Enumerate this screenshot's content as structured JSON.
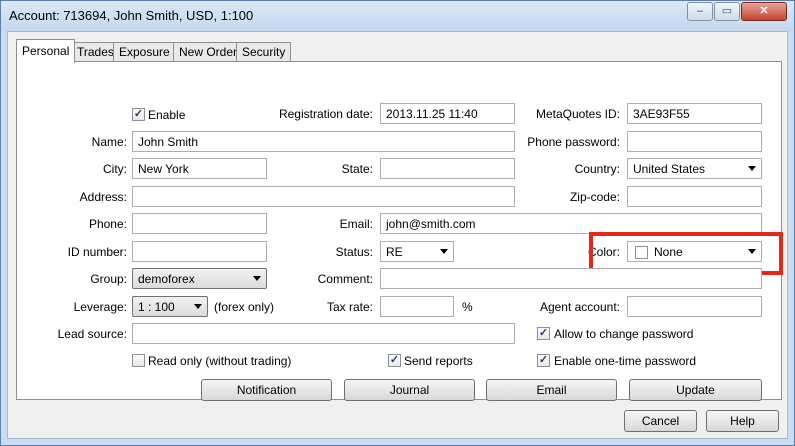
{
  "window": {
    "title": "Account: 713694, John Smith, USD, 1:100",
    "minimize_glyph": "–",
    "maximize_glyph": "▭",
    "close_glyph": "✕"
  },
  "tabs": [
    {
      "label": "Personal",
      "active": true
    },
    {
      "label": "Trades",
      "active": false
    },
    {
      "label": "Exposure",
      "active": false
    },
    {
      "label": "New Order",
      "active": false
    },
    {
      "label": "Security",
      "active": false
    }
  ],
  "form": {
    "enable": {
      "label": "Enable",
      "checked": true,
      "mark": "✓"
    },
    "registration_date": {
      "label": "Registration date:",
      "value": "2013.11.25 11:40"
    },
    "metaquotes_id": {
      "label": "MetaQuotes ID:",
      "value": "3AE93F55"
    },
    "name": {
      "label": "Name:",
      "value": "John Smith"
    },
    "phone_password": {
      "label": "Phone password:",
      "value": ""
    },
    "city": {
      "label": "City:",
      "value": "New York"
    },
    "state": {
      "label": "State:",
      "value": ""
    },
    "country": {
      "label": "Country:",
      "value": "United States"
    },
    "address": {
      "label": "Address:",
      "value": ""
    },
    "zip_code": {
      "label": "Zip-code:",
      "value": ""
    },
    "phone": {
      "label": "Phone:",
      "value": ""
    },
    "email": {
      "label": "Email:",
      "value": "john@smith.com"
    },
    "id_number": {
      "label": "ID number:",
      "value": ""
    },
    "status": {
      "label": "Status:",
      "value": "RE"
    },
    "color": {
      "label": "Color:",
      "value": "None"
    },
    "group": {
      "label": "Group:",
      "value": "demoforex"
    },
    "comment": {
      "label": "Comment:",
      "value": ""
    },
    "leverage": {
      "label": "Leverage:",
      "value": "1 : 100",
      "note": "(forex only)"
    },
    "tax_rate": {
      "label": "Tax rate:",
      "value": "",
      "unit": "%"
    },
    "agent_account": {
      "label": "Agent account:",
      "value": ""
    },
    "lead_source": {
      "label": "Lead source:",
      "value": ""
    },
    "allow_change_password": {
      "label": "Allow to change password",
      "checked": true,
      "mark": "✓"
    },
    "read_only": {
      "label": "Read only (without trading)",
      "checked": false,
      "mark": ""
    },
    "send_reports": {
      "label": "Send reports",
      "checked": true,
      "mark": "✓"
    },
    "enable_otp": {
      "label": "Enable one-time password",
      "checked": true,
      "mark": "✓"
    }
  },
  "actions": {
    "notification": "Notification",
    "journal": "Journal",
    "email": "Email",
    "update": "Update"
  },
  "footer": {
    "cancel": "Cancel",
    "help": "Help"
  },
  "colors": {
    "highlight": "#e8261b",
    "window_frame": "#c9dcf0"
  }
}
